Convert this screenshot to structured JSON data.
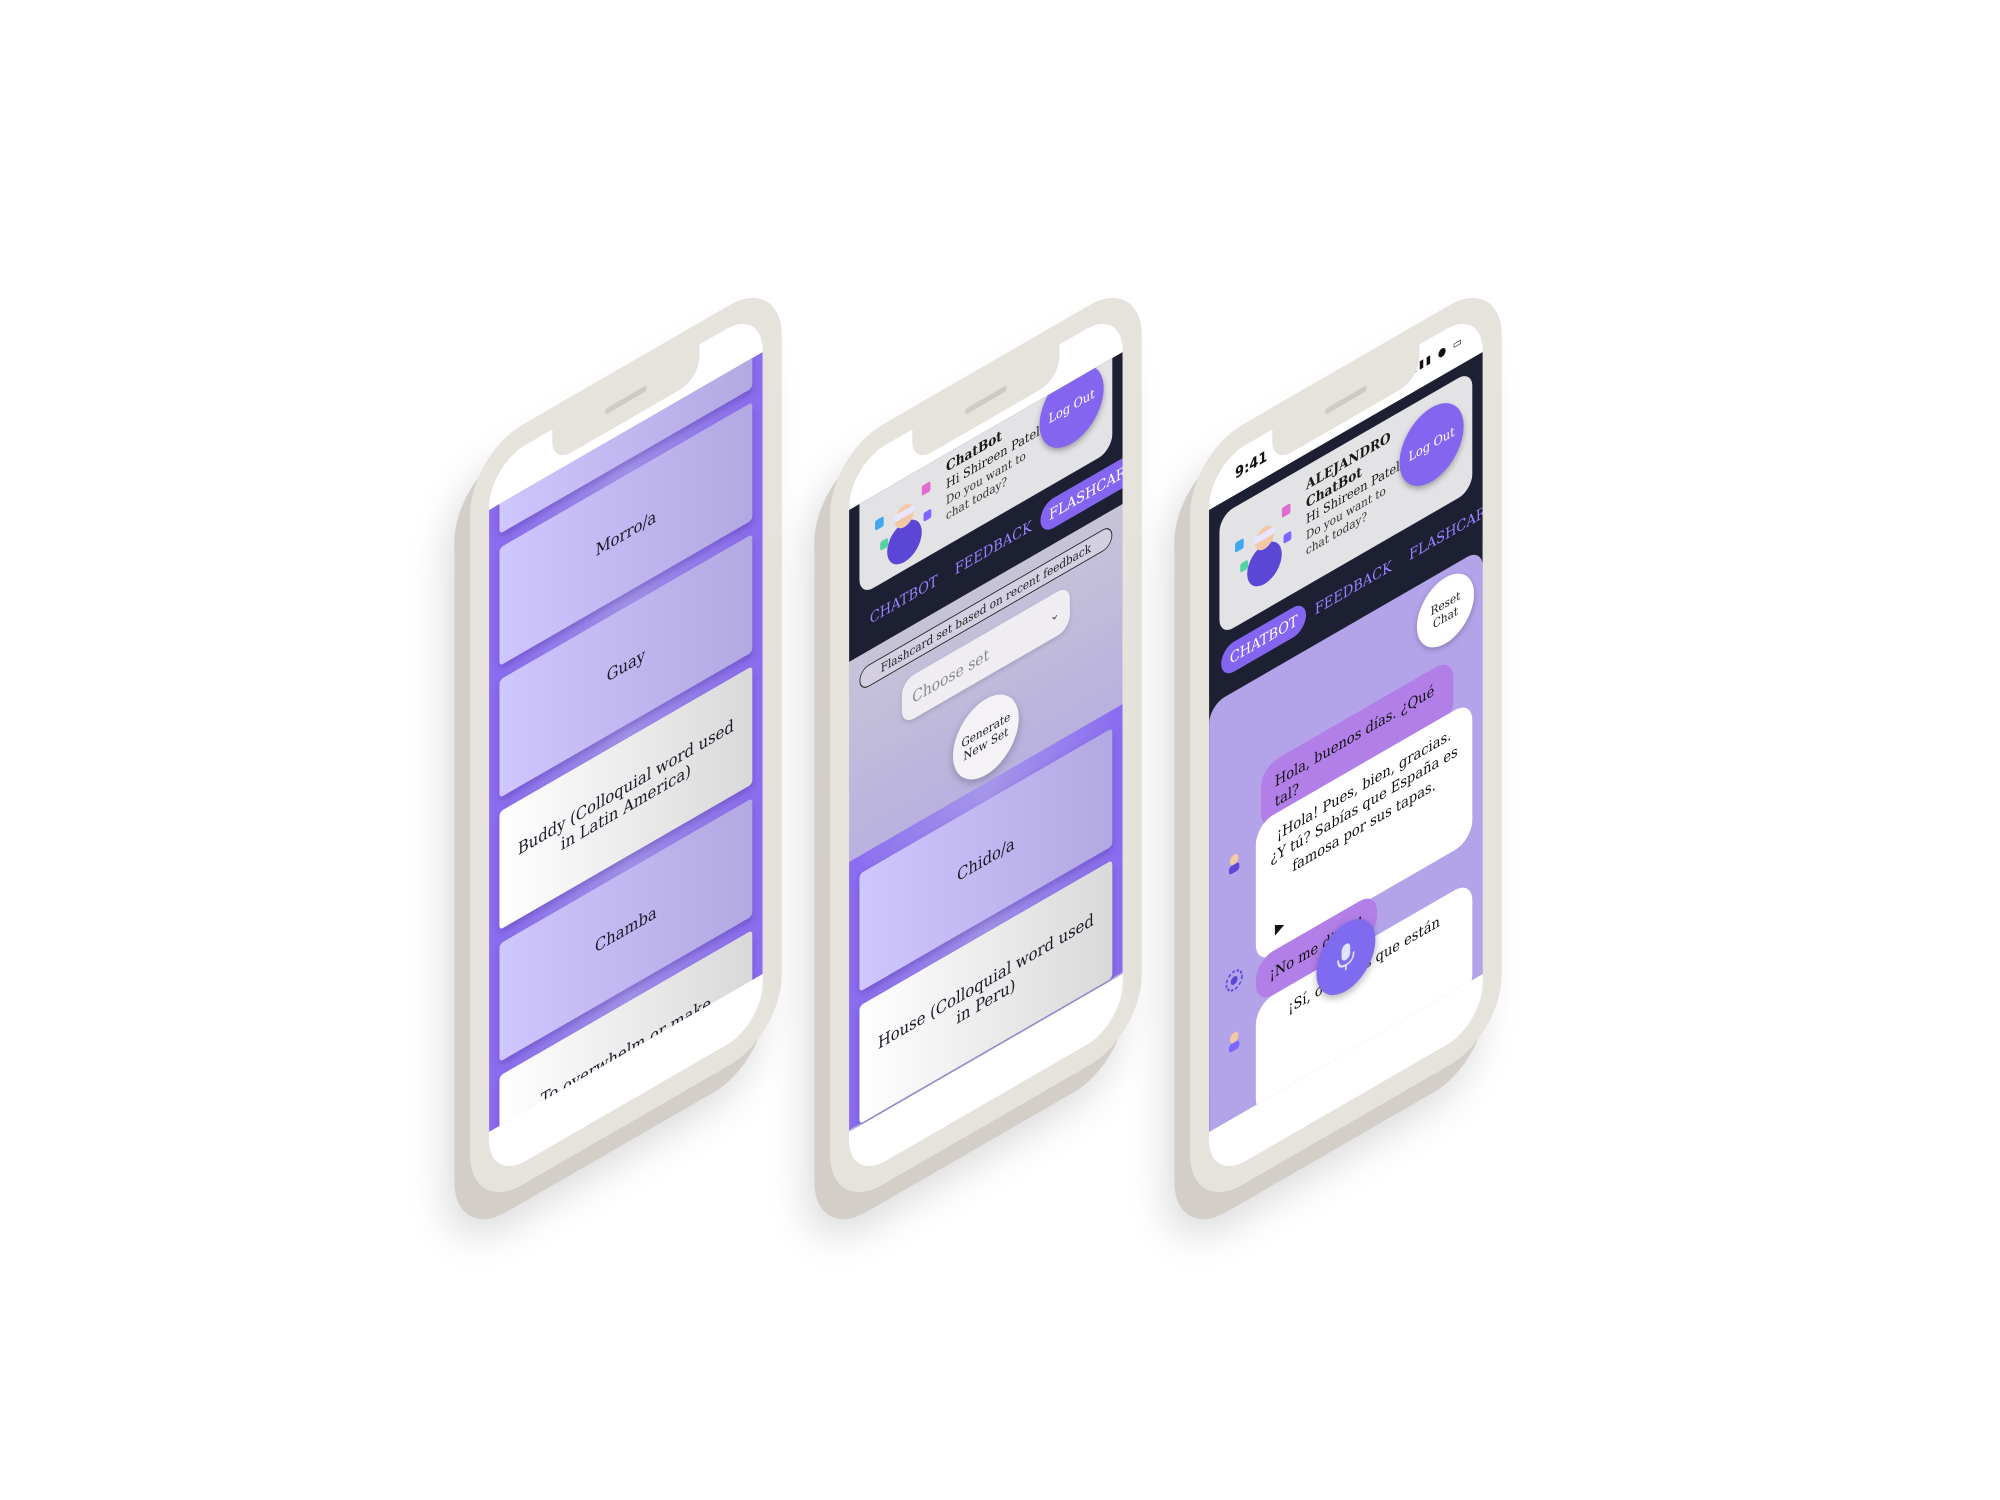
{
  "status": {
    "time": "9:41"
  },
  "phone1": {
    "cards": [
      {
        "text": "",
        "kind": "term"
      },
      {
        "text": "Morro/a",
        "kind": "term"
      },
      {
        "text": "Guay",
        "kind": "term"
      },
      {
        "text": "Buddy (Colloquial word used in Latin America)",
        "kind": "def"
      },
      {
        "text": "Chamba",
        "kind": "term"
      },
      {
        "text": "To overwhelm or make someone sick of something",
        "kind": "def"
      },
      {
        "text": "",
        "kind": "term"
      }
    ]
  },
  "phone2": {
    "header": {
      "name": "ChatBot",
      "greeting": "Hi Shireen Patel!",
      "question": "Do you want to chat today?",
      "logout_label": "Log Out"
    },
    "tabs": [
      {
        "label": "CHATBOT",
        "active": false
      },
      {
        "label": "FEEDBACK",
        "active": false
      },
      {
        "label": "FLASHCARDS",
        "active": true
      }
    ],
    "flashcard_set_label": "Flashcard set based on recent feedback",
    "select": {
      "placeholder": "Choose set"
    },
    "generate_label": "Generate New Set",
    "cards": [
      {
        "text": "Chido/a",
        "kind": "term"
      },
      {
        "text": "House (Colloquial word used in Peru)",
        "kind": "def"
      },
      {
        "text": "",
        "kind": "term"
      }
    ]
  },
  "phone3": {
    "header": {
      "name_line1": "ALEJANDRO",
      "name_line2": "ChatBot",
      "greeting": "Hi Shireen Patel!",
      "question": "Do you want to chat today?",
      "logout_label": "Log Out"
    },
    "tabs": [
      {
        "label": "CHATBOT",
        "active": true
      },
      {
        "label": "FEEDBACK",
        "active": false
      },
      {
        "label": "FLASHCARDS",
        "active": false
      }
    ],
    "reset_label": "Reset Chat",
    "messages": [
      {
        "role": "user",
        "text": "Hola, buenos días. ¿Qué tal?"
      },
      {
        "role": "bot",
        "text": "¡Hola! Pues, bien, gracias. ¿Y tú? Sabías que España es famosa por sus tapas."
      },
      {
        "role": "user",
        "text": "¡No me digas!"
      },
      {
        "role": "bot",
        "text": "¡Sí, o sea, es que están"
      }
    ]
  },
  "colors": {
    "accent": "#8465f0",
    "header_bg": "#1d2033",
    "chat_bg": "#b3a4ea",
    "user_bubble": "#b27ee8"
  }
}
